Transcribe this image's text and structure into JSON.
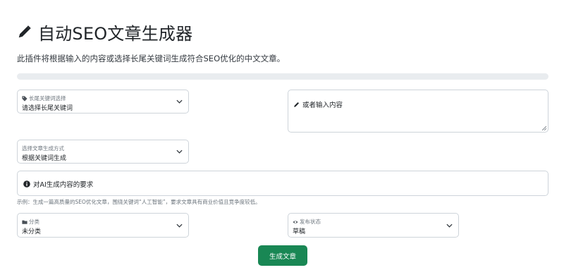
{
  "header": {
    "icon": "pencil-icon",
    "title": "自动SEO文章生成器",
    "description": "此插件将根据输入的内容或选择长尾关键词生成符合SEO优化的中文文章。"
  },
  "progress": {
    "value": 0
  },
  "keyword_select": {
    "icon": "tag-icon",
    "label": "长尾关键词选择",
    "value": "请选择长尾关键词"
  },
  "content_input": {
    "icon": "pencil-icon",
    "placeholder": "或者输入内容"
  },
  "method_select": {
    "label": "选择文章生成方式",
    "value": "根据关键词生成"
  },
  "ai_prompt": {
    "icon": "info-circle-icon",
    "placeholder": "对AI生成内容的要求",
    "example": "示例：生成一篇高质量的SEO优化文章，围绕关键词“人工智能”，要求文章具有商业价值且竞争度较低。"
  },
  "category_select": {
    "icon": "folder-icon",
    "label": "分类",
    "value": "未分类"
  },
  "status_select": {
    "icon": "eye-icon",
    "label": "发布状态",
    "value": "草稿"
  },
  "actions": {
    "generate_label": "生成文章"
  },
  "colors": {
    "primary_button": "#198754",
    "border": "#ced4da",
    "progress_track": "#e9ecef"
  }
}
